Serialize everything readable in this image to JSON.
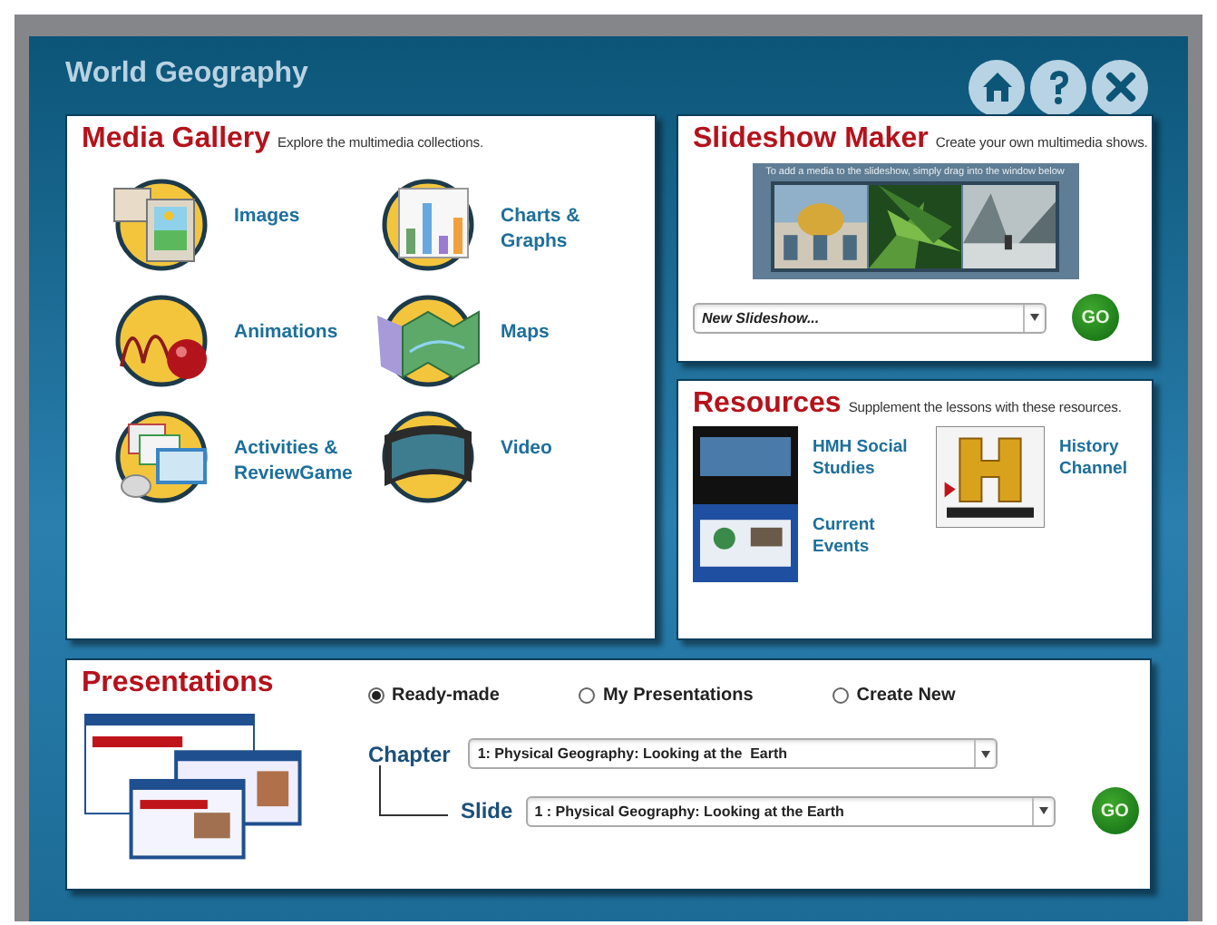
{
  "window": {
    "title": "World Geography"
  },
  "toolbar_buttons": [
    {
      "kind": "home"
    },
    {
      "kind": "help"
    },
    {
      "kind": "close"
    }
  ],
  "media_gallery": {
    "title": "Media Gallery",
    "subtitle": "Explore the multimedia collections.",
    "items": [
      {
        "label": "Images",
        "kind": "images"
      },
      {
        "label": "Charts & Graphs",
        "kind": "charts"
      },
      {
        "label": "Animations",
        "kind": "animations"
      },
      {
        "label": "Maps",
        "kind": "maps"
      },
      {
        "label": "Activities & ReviewGame",
        "kind": "activities"
      },
      {
        "label": "Video",
        "kind": "video"
      }
    ]
  },
  "slideshow_maker": {
    "title": "Slideshow Maker",
    "subtitle": "Create your own multimedia shows.",
    "hint": "To add a media to the slideshow, simply drag into the window below",
    "dropdown": {
      "value": "New Slideshow..."
    },
    "go": "GO"
  },
  "resources": {
    "title": "Resources",
    "subtitle": "Supplement the lessons with these resources.",
    "links": [
      {
        "label": "HMH Social Studies"
      },
      {
        "label": "Current Events"
      },
      {
        "label": "History Channel"
      }
    ]
  },
  "presentations": {
    "title": "Presentations",
    "options": [
      {
        "label": "Ready-made",
        "selected": true
      },
      {
        "label": "My Presentations",
        "selected": false
      },
      {
        "label": "Create New",
        "selected": false
      }
    ],
    "chapter": {
      "label": "Chapter",
      "value": "1: Physical Geography: Looking at the  Earth"
    },
    "slide": {
      "label": "Slide",
      "value": "1 : Physical Geography: Looking at the Earth"
    },
    "go": "GO"
  }
}
